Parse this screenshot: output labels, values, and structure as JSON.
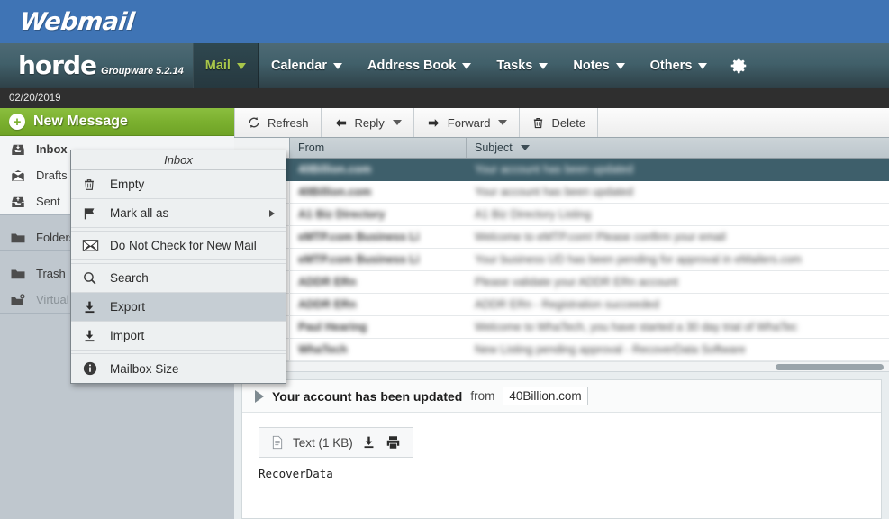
{
  "banner": {
    "brand": "Webmail"
  },
  "navbar": {
    "logo_main": "horde",
    "logo_sub": "Groupware 5.2.14",
    "items": [
      {
        "label": "Mail",
        "active": true,
        "icon": "chevron-down-icon"
      },
      {
        "label": "Calendar",
        "active": false,
        "icon": "chevron-down-icon"
      },
      {
        "label": "Address Book",
        "active": false,
        "icon": "chevron-down-icon"
      },
      {
        "label": "Tasks",
        "active": false,
        "icon": "chevron-down-icon"
      },
      {
        "label": "Notes",
        "active": false,
        "icon": "chevron-down-icon"
      },
      {
        "label": "Others",
        "active": false,
        "icon": "chevron-down-icon"
      }
    ],
    "settings_icon": "gear-icon",
    "accent_active": "#a8c64a",
    "banner_blue": "#3f74b5"
  },
  "datestrip": {
    "date": "02/20/2019"
  },
  "sidebar": {
    "new_message_label": "New Message",
    "new_message_icon": "plus-circle-icon",
    "groups": [
      {
        "items": [
          {
            "label": "Inbox",
            "icon": "inbox-icon",
            "selected": true,
            "dim": false
          },
          {
            "label": "Drafts",
            "icon": "drafts-envelope-icon",
            "selected": false,
            "dim": false
          },
          {
            "label": "Sent",
            "icon": "sent-icon",
            "selected": false,
            "dim": false
          }
        ]
      },
      {
        "items": [
          {
            "label": "Folders",
            "icon": "folder-icon",
            "selected": false,
            "dim": false
          }
        ]
      },
      {
        "items": [
          {
            "label": "Trash",
            "icon": "folder-icon",
            "selected": false,
            "dim": false
          },
          {
            "label": "Virtual Folders",
            "icon": "virtual-folder-icon",
            "selected": false,
            "dim": true
          }
        ]
      }
    ]
  },
  "toolbar": {
    "buttons": [
      {
        "label": "Refresh",
        "icon": "refresh-icon",
        "caret": false
      },
      {
        "label": "Reply",
        "icon": "arrow-left-icon",
        "caret": true
      },
      {
        "label": "Forward",
        "icon": "arrow-right-icon",
        "caret": true
      },
      {
        "label": "Delete",
        "icon": "trash-icon",
        "caret": false
      }
    ]
  },
  "message_list": {
    "columns": {
      "from": "From",
      "subject": "Subject",
      "sort_icon": "chevron-down-icon"
    },
    "rows": [
      {
        "from": "40Billion.com",
        "subject": "Your account has been updated",
        "selected": true
      },
      {
        "from": "40Billion.com",
        "subject": "Your account has been updated",
        "selected": false
      },
      {
        "from": "A1 Biz Directory",
        "subject": "A1 Biz Directory Listing",
        "selected": false
      },
      {
        "from": "eMTP.com Business Li",
        "subject": "Welcome to eMTP.com! Please confirm your email",
        "selected": false
      },
      {
        "from": "eMTP.com Business Li",
        "subject": "Your business UD has been pending for approval in eMailers.com",
        "selected": false
      },
      {
        "from": "ADDR ERn",
        "subject": "Please validate your ADDR ERn account",
        "selected": false
      },
      {
        "from": "ADDR ERn",
        "subject": "ADDR ERn - Registration succeeded",
        "selected": false
      },
      {
        "from": "Paul Hearing",
        "subject": "Welcome to WhaTech, you have started a 30 day trial of WhaTec",
        "selected": false
      },
      {
        "from": "WhaTech",
        "subject": "New Listing pending approval - RecoverData Software",
        "selected": false
      }
    ],
    "selected_row_color": "#3e5f6b"
  },
  "context_menu": {
    "title": "Inbox",
    "items": [
      {
        "label": "Empty",
        "icon": "trash-icon",
        "submenu": false,
        "highlighted": false
      },
      {
        "label": "Mark all as",
        "icon": "flag-icon",
        "submenu": true,
        "highlighted": false
      },
      {
        "label": "Do Not Check for New Mail",
        "icon": "envelope-icon",
        "submenu": false,
        "highlighted": false
      },
      {
        "label": "Search",
        "icon": "magnifier-icon",
        "submenu": false,
        "highlighted": false
      },
      {
        "label": "Export",
        "icon": "download-icon",
        "submenu": false,
        "highlighted": true
      },
      {
        "label": "Import",
        "icon": "download-icon",
        "submenu": false,
        "highlighted": false
      },
      {
        "label": "Mailbox Size",
        "icon": "info-icon",
        "submenu": false,
        "highlighted": false
      }
    ]
  },
  "preview": {
    "expand_icon": "triangle-right-icon",
    "subject": "Your account has been updated",
    "from_label": "from",
    "sender": "40Billion.com",
    "attachment": {
      "icon": "document-icon",
      "label": "Text (1 KB)",
      "download_icon": "download-icon",
      "print_icon": "printer-icon"
    },
    "body_first_line": "RecoverData"
  }
}
